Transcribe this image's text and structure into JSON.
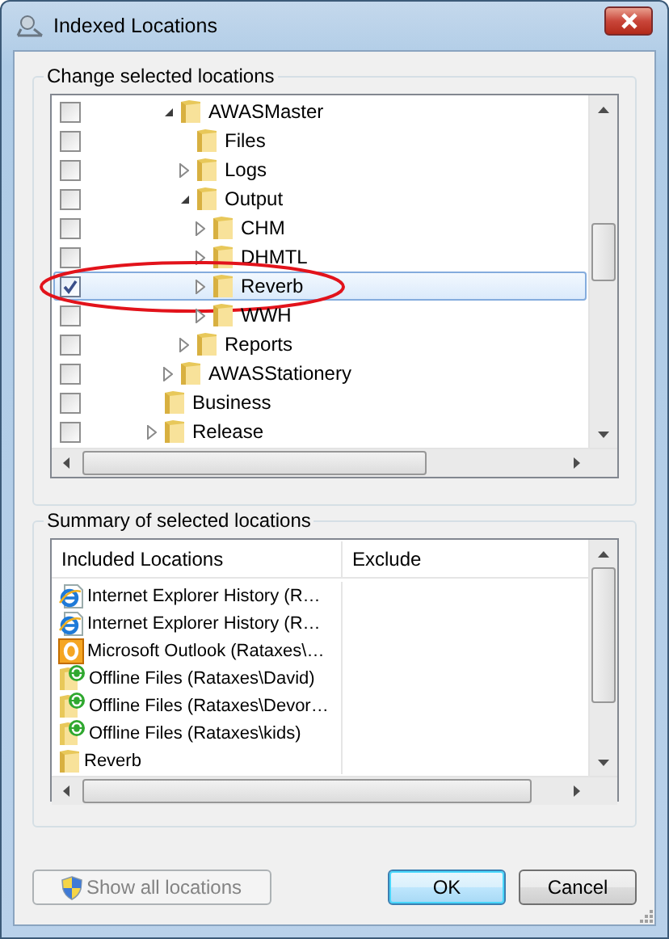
{
  "window": {
    "title": "Indexed Locations"
  },
  "locations": {
    "title": "Change selected locations",
    "tree": [
      {
        "children": [
          {
            "children": [
              {
                "label": "AWASMaster",
                "checked": false,
                "selected": false,
                "circled": false,
                "expanded": true,
                "children": [
                  {
                    "label": "Files",
                    "checked": false,
                    "selected": false,
                    "circled": false
                  },
                  {
                    "label": "Logs",
                    "checked": false,
                    "selected": false,
                    "circled": false,
                    "expanded": false
                  },
                  {
                    "label": "Output",
                    "checked": false,
                    "selected": false,
                    "circled": false,
                    "expanded": true,
                    "children": [
                      {
                        "label": "CHM",
                        "checked": false,
                        "selected": false,
                        "circled": false,
                        "expanded": false
                      },
                      {
                        "label": "DHMTL",
                        "checked": false,
                        "selected": false,
                        "circled": false,
                        "expanded": false
                      },
                      {
                        "label": "Reverb",
                        "checked": true,
                        "selected": true,
                        "circled": true,
                        "expanded": false
                      },
                      {
                        "label": "WWH",
                        "checked": false,
                        "selected": false,
                        "circled": false,
                        "expanded": false
                      }
                    ]
                  },
                  {
                    "label": "Reports",
                    "checked": false,
                    "selected": false,
                    "circled": false,
                    "expanded": false
                  }
                ]
              },
              {
                "label": "AWASStationery",
                "checked": false,
                "selected": false,
                "circled": false,
                "expanded": false
              }
            ]
          },
          {
            "label": "Business",
            "checked": false,
            "selected": false,
            "circled": false
          },
          {
            "label": "Release",
            "checked": false,
            "selected": false,
            "circled": false,
            "expanded": false
          }
        ]
      }
    ]
  },
  "summary": {
    "title": "Summary of selected locations",
    "columns": [
      "Included Locations",
      "Exclude"
    ],
    "rows": [
      {
        "kind": "ie",
        "label": "Internet Explorer History (R…"
      },
      {
        "kind": "ie",
        "label": "Internet Explorer History (R…"
      },
      {
        "kind": "outlook",
        "label": "Microsoft Outlook (Rataxes\\…"
      },
      {
        "kind": "offline",
        "label": "Offline Files (Rataxes\\David)"
      },
      {
        "kind": "offline",
        "label": "Offline Files (Rataxes\\Devor…"
      },
      {
        "kind": "offline",
        "label": "Offline Files (Rataxes\\kids)"
      },
      {
        "kind": "folder",
        "label": "Reverb"
      }
    ]
  },
  "buttons": [
    {
      "kind": "shield",
      "label": "Show all locations",
      "disabled": true,
      "default": false
    },
    {
      "kind": "plain",
      "label": "OK",
      "disabled": false,
      "default": true
    },
    {
      "kind": "plain",
      "label": "Cancel",
      "disabled": false,
      "default": false
    }
  ]
}
